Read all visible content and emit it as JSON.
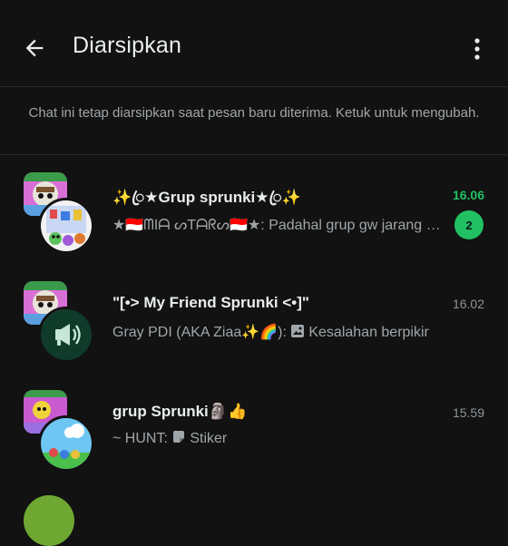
{
  "header": {
    "title": "Diarsipkan",
    "back_icon": "arrow-left-icon",
    "menu_icon": "more-vertical-icon"
  },
  "notice": "Chat ini tetap diarsipkan saat pesan baru diterima. Ketuk untuk mengubah.",
  "chats": [
    {
      "name": "✨ꦿ★Grup sprunki★ꦿ✨",
      "time": "16.06",
      "preview": "★🇮🇩ᗰIᗩ ᔕTᗩᖇᔕ🇮🇩★: Padahal grup gw jarang aktif",
      "unread": "2"
    },
    {
      "name": "\"[•> My Friend Sprunki <•]\"",
      "time": "16.02",
      "preview_sender": "Gray PDI (AKA Ziaa✨🌈):",
      "preview_icon": "image-icon",
      "preview_text": "Kesalahan berpikir"
    },
    {
      "name": "grup Sprunki🗿👍",
      "time": "15.59",
      "preview_sender": "~ HUNT:",
      "preview_icon": "sticker-icon",
      "preview_text": "Stiker"
    }
  ],
  "colors": {
    "background": "#121212",
    "accent": "#21c063",
    "secondary_text": "#a0a6aa"
  }
}
